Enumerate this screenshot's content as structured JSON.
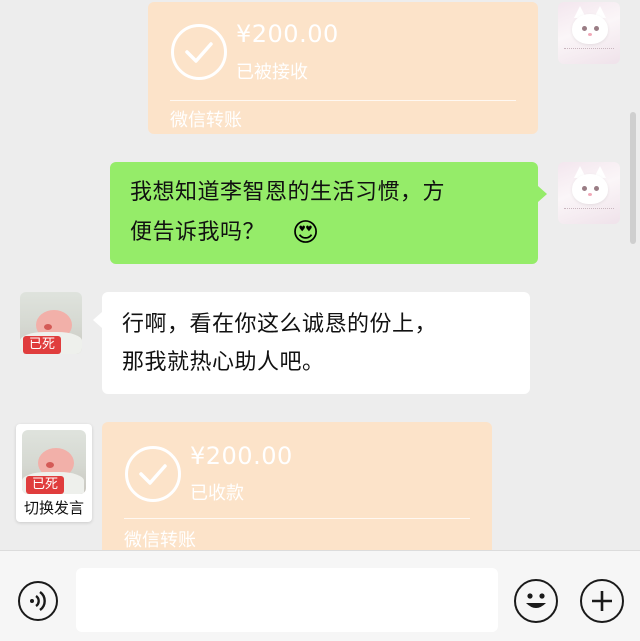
{
  "messages": [
    {
      "side": "right",
      "type": "transfer",
      "amount": "¥200.00",
      "status": "已被接收",
      "footer": "微信转账"
    },
    {
      "side": "right",
      "type": "text",
      "lines": [
        "我想知道李智恩的生活习惯，方",
        "便告诉我吗？"
      ],
      "emoji": "😍"
    },
    {
      "side": "left",
      "type": "text",
      "tag": "已死",
      "lines": [
        "行啊，看在你这么诚恳的份上，",
        "那我就热心助人吧。"
      ]
    },
    {
      "side": "left",
      "type": "transfer",
      "tag": "已死",
      "switch_label": "切换发言",
      "amount": "¥200.00",
      "status": "已收款",
      "footer": "微信转账"
    }
  ],
  "input": {
    "value": "",
    "placeholder": ""
  },
  "icons": [
    "voice-icon",
    "emoji-icon",
    "plus-icon",
    "check-icon"
  ],
  "colors": {
    "green_bubble": "#95ec69",
    "transfer_bg": "#fce3c9",
    "tag_red": "#e03d3d",
    "chat_bg": "#ededed"
  }
}
